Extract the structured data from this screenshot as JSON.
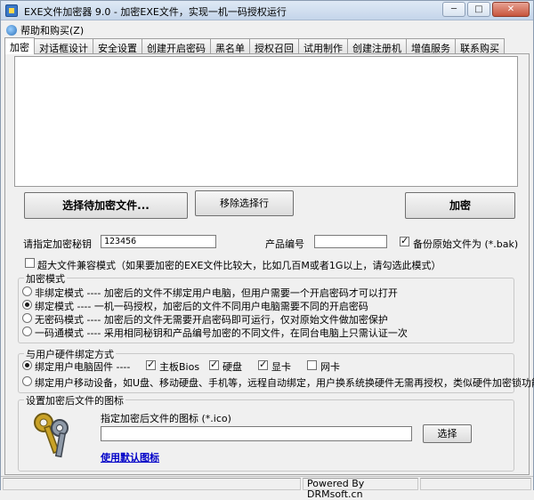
{
  "window": {
    "title": "EXE文件加密器 9.0 - 加密EXE文件，实现一机一码授权运行",
    "minimize": "─",
    "maximize": "□",
    "close": "✕"
  },
  "menu": {
    "help": "帮助和购买(Z)"
  },
  "tabs": [
    "加密",
    "对话框设计",
    "安全设置",
    "创建开启密码",
    "黑名单",
    "授权召回",
    "试用制作",
    "创建注册机",
    "增值服务",
    "联系购买"
  ],
  "actions": {
    "select_files": "选择待加密文件...",
    "remove_selected": "移除选择行",
    "encrypt": "加密"
  },
  "form": {
    "secret_label": "请指定加密秘钥",
    "secret_value": "123456",
    "product_label": "产品编号",
    "product_value": "",
    "backup_label": "备份原始文件为 (*.bak)",
    "backup_checked": true,
    "large_file_label": "超大文件兼容模式（如果要加密的EXE文件比较大，比如几百M或者1G以上，请勾选此模式）",
    "large_file_checked": false
  },
  "encrypt_mode": {
    "title": "加密模式",
    "options": [
      {
        "label": "非绑定模式 ---- 加密后的文件不绑定用户电脑，但用户需要一个开启密码才可以打开",
        "selected": false
      },
      {
        "label": "绑定模式 ---- 一机一码授权，加密后的文件不同用户电脑需要不同的开启密码",
        "selected": true
      },
      {
        "label": "无密码模式 ---- 加密后的文件无需要开启密码即可运行，仅对原始文件做加密保护",
        "selected": false
      },
      {
        "label": "一码通模式 ---- 采用相同秘钥和产品编号加密的不同文件，在同台电脑上只需认证一次",
        "selected": false
      }
    ]
  },
  "hardware_bind": {
    "title": "与用户硬件绑定方式",
    "fixed_label": "绑定用户电脑固件 ----",
    "fixed_selected": true,
    "components": [
      {
        "label": "主板Bios",
        "checked": true
      },
      {
        "label": "硬盘",
        "checked": true
      },
      {
        "label": "显卡",
        "checked": true
      },
      {
        "label": "网卡",
        "checked": false
      }
    ],
    "mobile_label": "绑定用户移动设备，如U盘、移动硬盘、手机等，远程自动绑定，用户换系统换硬件无需再授权，类似硬件加密锁功能",
    "mobile_selected": false
  },
  "icon_settings": {
    "title": "设置加密后文件的图标",
    "file_label": "指定加密后文件的图标 (*.ico)",
    "file_value": "",
    "browse": "选择",
    "default_link": "使用默认图标"
  },
  "statusbar": {
    "powered_by": "Powered By DRMsoft.cn"
  },
  "colors": {
    "link": "#0000c8",
    "titlebar": "#c4d5ea"
  }
}
